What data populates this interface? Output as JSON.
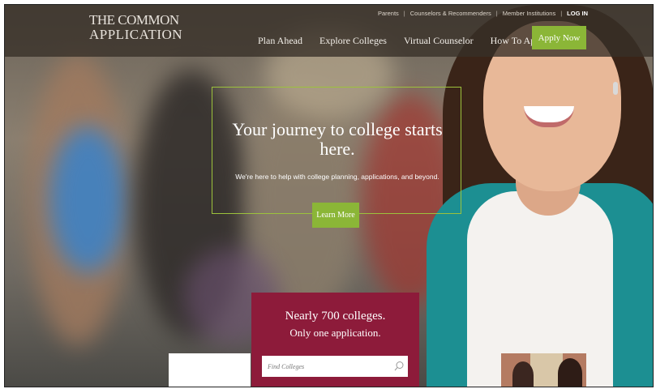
{
  "header": {
    "logo_line1": "THE COMMON",
    "logo_line2": "APPLICATION",
    "utility_links": [
      "Parents",
      "Counselors & Recommenders",
      "Member Institutions"
    ],
    "login_label": "LOG IN",
    "nav": [
      "Plan Ahead",
      "Explore Colleges",
      "Virtual Counselor",
      "How To Apply"
    ],
    "apply_label": "Apply Now"
  },
  "hero": {
    "title": "Your journey to college starts here.",
    "subtitle": "We're here to help with college planning, applications, and beyond.",
    "cta_label": "Learn More"
  },
  "promo": {
    "line1": "Nearly 700 colleges.",
    "line2": "Only one application.",
    "search_placeholder": "Find Colleges"
  },
  "colors": {
    "accent_green": "#8bb637",
    "maroon": "#8d1b3a",
    "header_bg": "#373028"
  }
}
